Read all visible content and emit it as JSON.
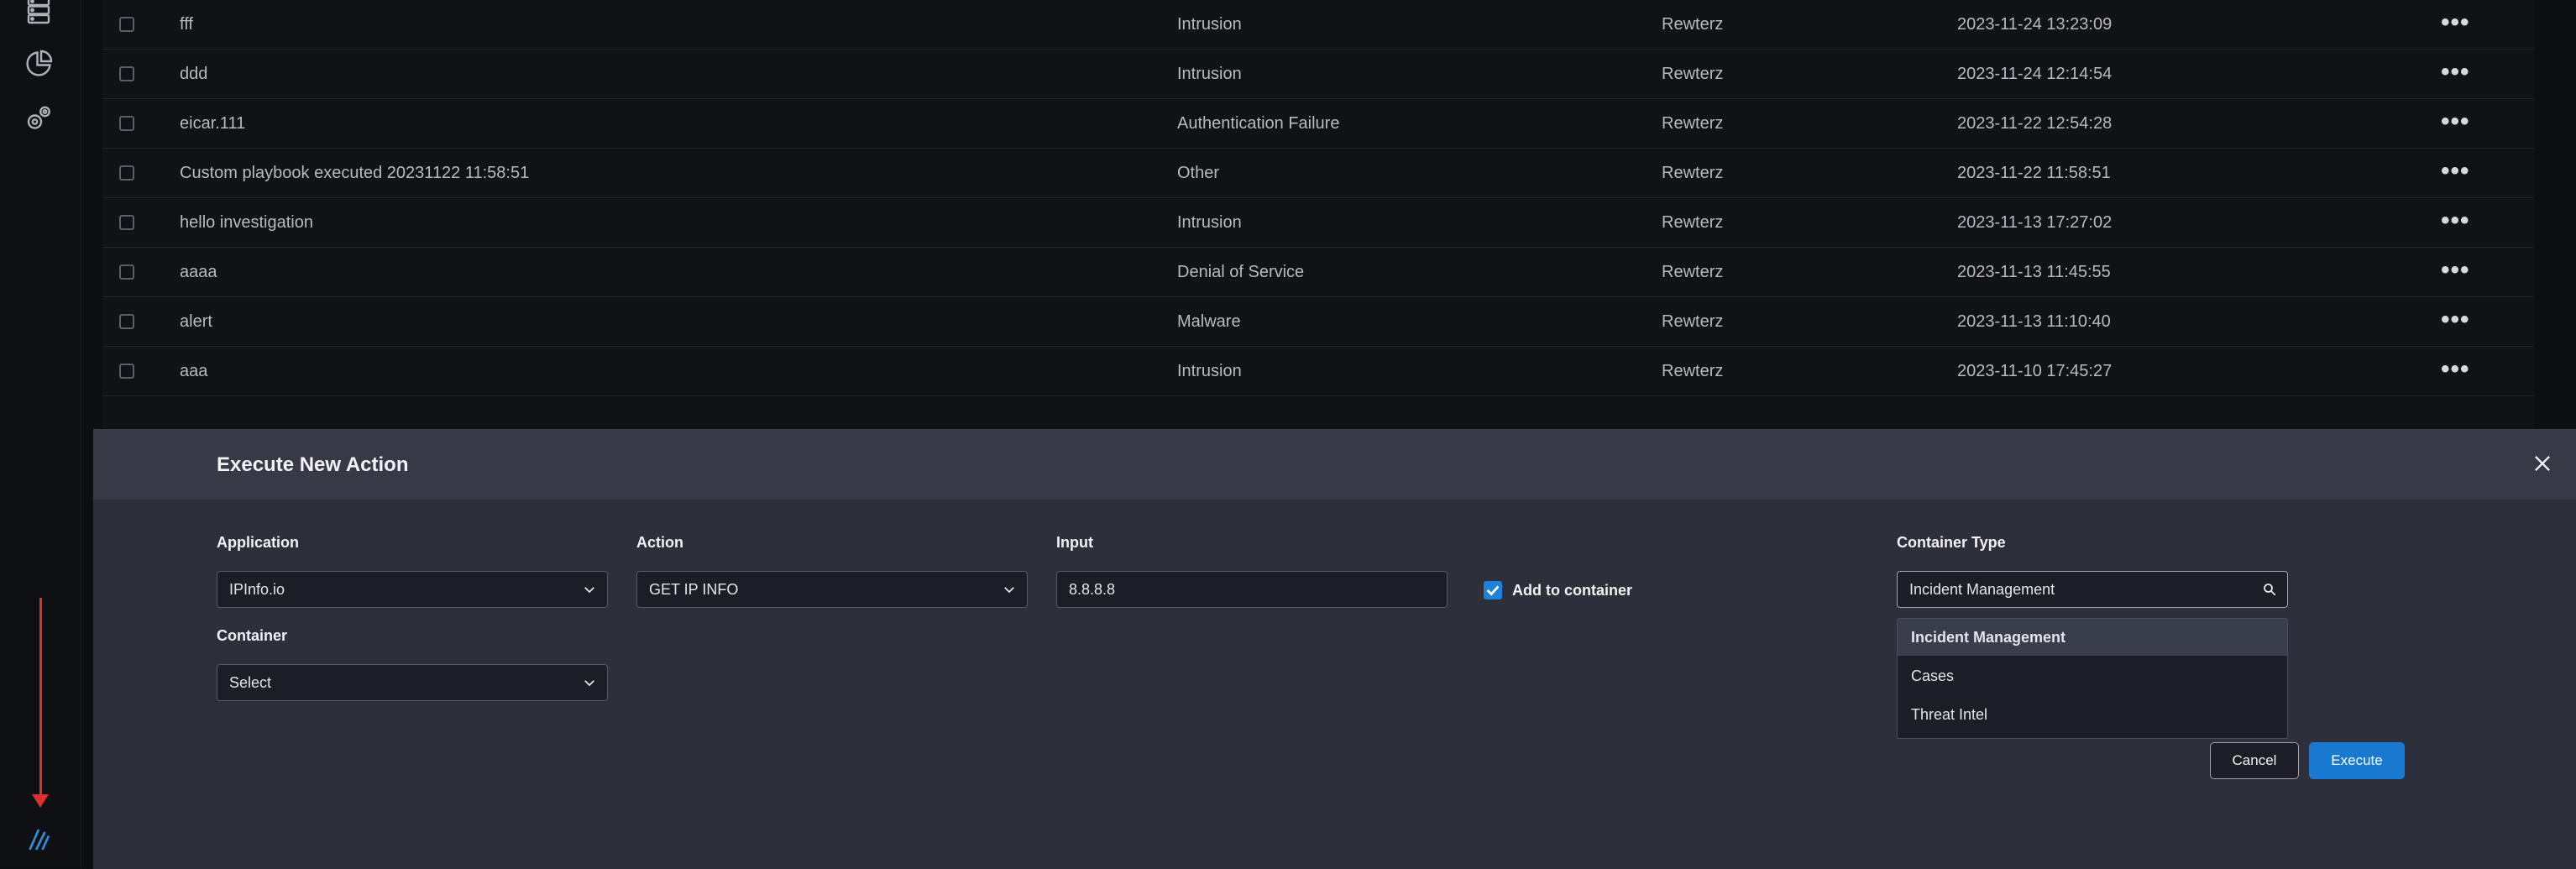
{
  "sidebar": {
    "icons": [
      "database-icon",
      "pie-chart-icon",
      "settings-gears-icon",
      "logo-icon"
    ]
  },
  "table": {
    "rows": [
      {
        "name": "fff",
        "type": "Intrusion",
        "owner": "Rewterz",
        "date": "2023-11-24 13:23:09"
      },
      {
        "name": "ddd",
        "type": "Intrusion",
        "owner": "Rewterz",
        "date": "2023-11-24 12:14:54"
      },
      {
        "name": "eicar.111",
        "type": "Authentication Failure",
        "owner": "Rewterz",
        "date": "2023-11-22 12:54:28"
      },
      {
        "name": "Custom playbook executed 20231122 11:58:51",
        "type": "Other",
        "owner": "Rewterz",
        "date": "2023-11-22 11:58:51"
      },
      {
        "name": "hello investigation",
        "type": "Intrusion",
        "owner": "Rewterz",
        "date": "2023-11-13 17:27:02"
      },
      {
        "name": "aaaa",
        "type": "Denial of Service",
        "owner": "Rewterz",
        "date": "2023-11-13 11:45:55"
      },
      {
        "name": "alert",
        "type": "Malware",
        "owner": "Rewterz",
        "date": "2023-11-13 11:10:40"
      },
      {
        "name": "aaa",
        "type": "Intrusion",
        "owner": "Rewterz",
        "date": "2023-11-10 17:45:27"
      }
    ],
    "more_icon": "•••"
  },
  "modal": {
    "title": "Execute New Action",
    "application": {
      "label": "Application",
      "value": "IPInfo.io"
    },
    "action": {
      "label": "Action",
      "value": "GET IP INFO"
    },
    "input": {
      "label": "Input",
      "value": "8.8.8.8"
    },
    "add_to_container": {
      "label": "Add to container",
      "checked": true
    },
    "container_type": {
      "label": "Container Type",
      "value": "Incident Management",
      "options": [
        "Incident Management",
        "Cases",
        "Threat Intel"
      ]
    },
    "container": {
      "label": "Container",
      "value": "Select"
    },
    "cancel_label": "Cancel",
    "execute_label": "Execute"
  },
  "colors": {
    "accent": "#1979d1",
    "annotation_arrow": "#e0302b"
  }
}
